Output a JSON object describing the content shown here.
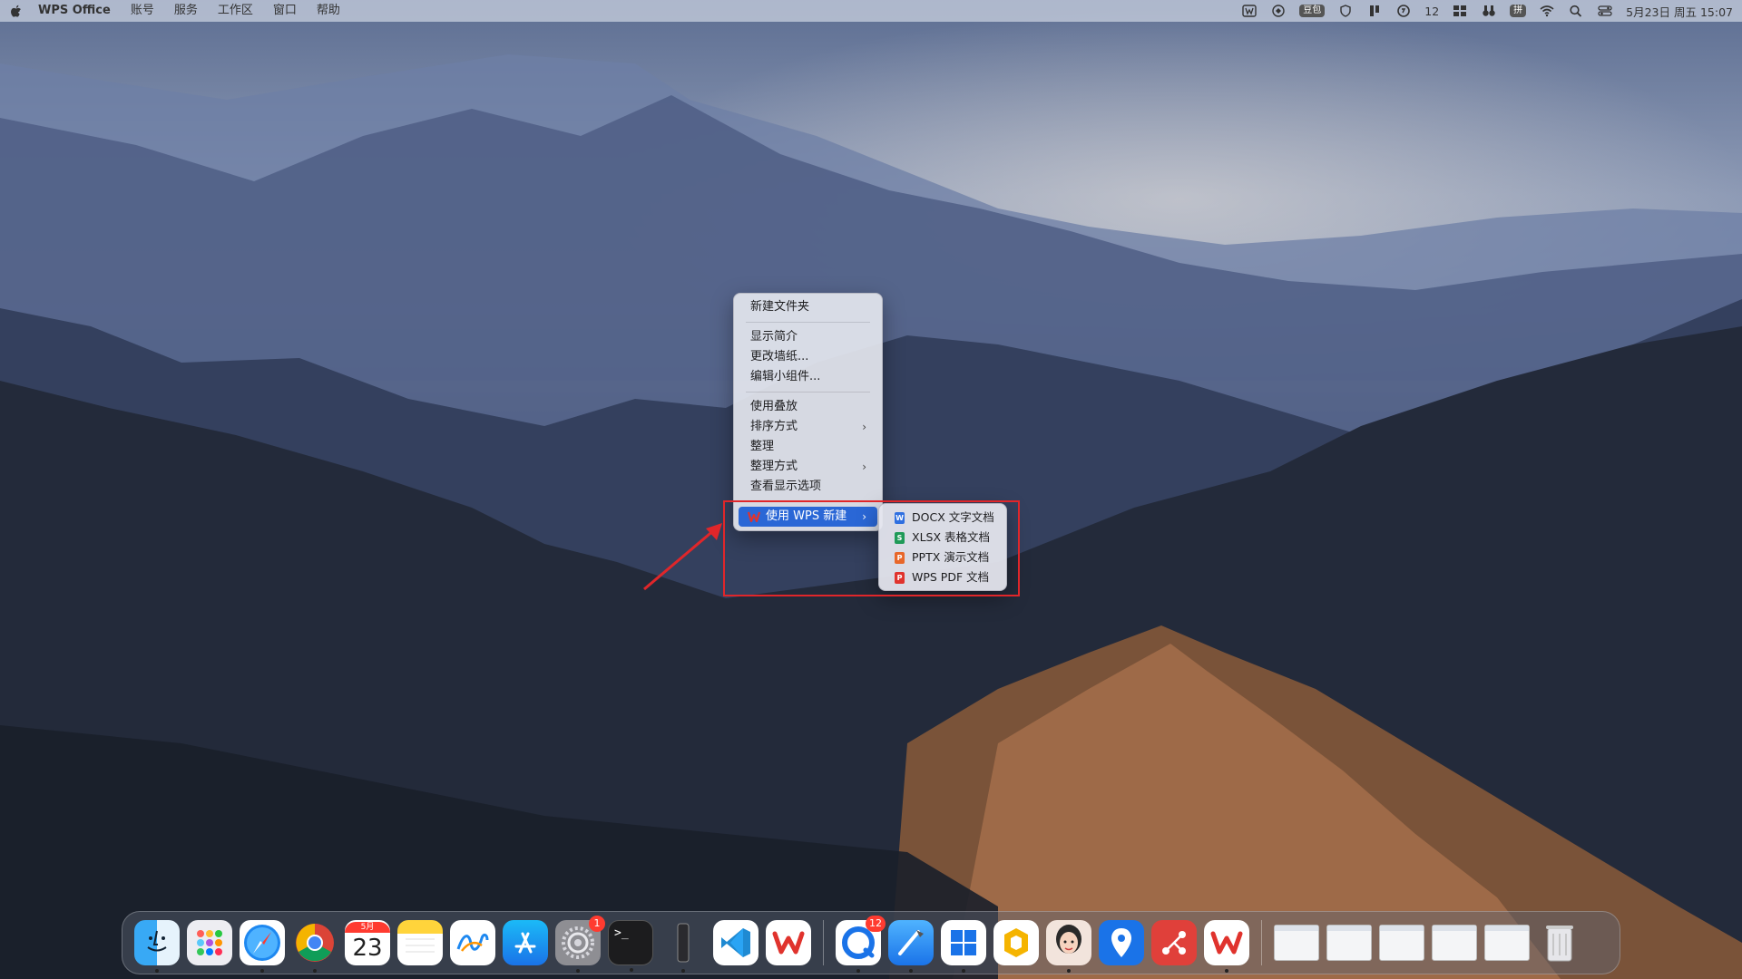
{
  "menubar": {
    "apple_icon": "apple-icon",
    "app_name": "WPS Office",
    "menus": [
      "账号",
      "服务",
      "工作区",
      "窗口",
      "帮助"
    ],
    "status": {
      "input_badge": "豆包",
      "notification_count": "12",
      "input_method_badge": "拼",
      "datetime": "5月23日 周五  15:07"
    }
  },
  "context_menu": {
    "items": [
      {
        "label": "新建文件夹"
      },
      {
        "label": "显示简介"
      },
      {
        "label": "更改墙纸..."
      },
      {
        "label": "编辑小组件..."
      },
      {
        "label": "使用叠放"
      },
      {
        "label": "排序方式",
        "has_submenu": true
      },
      {
        "label": "整理"
      },
      {
        "label": "整理方式",
        "has_submenu": true
      },
      {
        "label": "查看显示选项"
      },
      {
        "label": "使用 WPS 新建",
        "has_submenu": true,
        "active": true
      }
    ],
    "chevron": "›"
  },
  "submenu": {
    "items": [
      {
        "label": "DOCX 文字文档",
        "icon": "W",
        "color": "#2f6fe0"
      },
      {
        "label": "XLSX 表格文档",
        "icon": "S",
        "color": "#1f9a58"
      },
      {
        "label": "PPTX 演示文档",
        "icon": "P",
        "color": "#e8672a"
      },
      {
        "label": "WPS PDF 文档",
        "icon": "P",
        "color": "#e0332d"
      }
    ]
  },
  "dock": {
    "calendar_month": "5月",
    "calendar_day": "23",
    "settings_badge": "1",
    "qq_badge": "12",
    "terminal_prompt": ">_",
    "apps": [
      "finder",
      "launchpad",
      "safari",
      "chrome",
      "calendar",
      "notes",
      "freeform",
      "app-store",
      "system-settings",
      "terminal",
      "phone-mirroring",
      "vs-code",
      "wps-office",
      "qq-browser",
      "xcode",
      "windows-app",
      "pages-cleaner",
      "avatar-app",
      "maps-pin",
      "gitmind",
      "wps-office-2",
      "downloads-folder",
      "trash"
    ]
  },
  "colors": {
    "accent": "#2a67d6",
    "highlight": "#e0262a"
  }
}
